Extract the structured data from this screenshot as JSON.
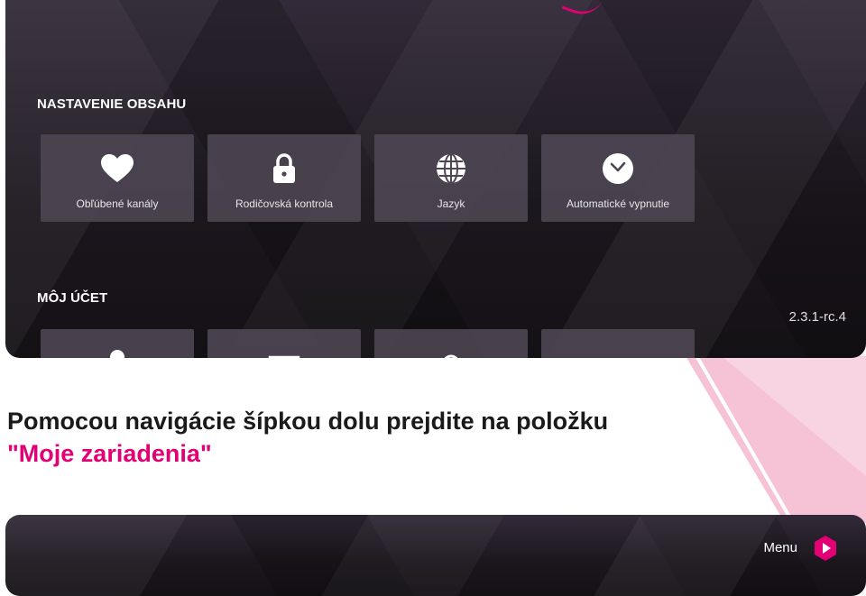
{
  "settings_panel": {
    "content_section": {
      "title": "NASTAVENIE OBSAHU",
      "tiles": [
        {
          "label": "Obľúbené kanály",
          "icon": "heart-icon"
        },
        {
          "label": "Rodičovská kontrola",
          "icon": "lock-icon"
        },
        {
          "label": "Jazyk",
          "icon": "globe-icon"
        },
        {
          "label": "Automatické vypnutie",
          "icon": "clock-icon"
        }
      ]
    },
    "account_section": {
      "title": "MÔJ ÚČET",
      "tiles": [
        {
          "icon": "user-icon"
        },
        {
          "icon": "screen-icon"
        },
        {
          "icon": "location-icon"
        },
        {
          "icon": "power-icon"
        }
      ]
    },
    "version": "2.3.1-rc.4"
  },
  "instruction": {
    "text": "Pomocou navigácie šípkou dolu prejdite na položku",
    "highlight": "\"Moje zariadenia\""
  },
  "second_panel": {
    "menu_label": "Menu"
  },
  "colors": {
    "accent": "#e20074",
    "tile_bg": "#4e4652",
    "panel_bg": "#1b161d"
  }
}
